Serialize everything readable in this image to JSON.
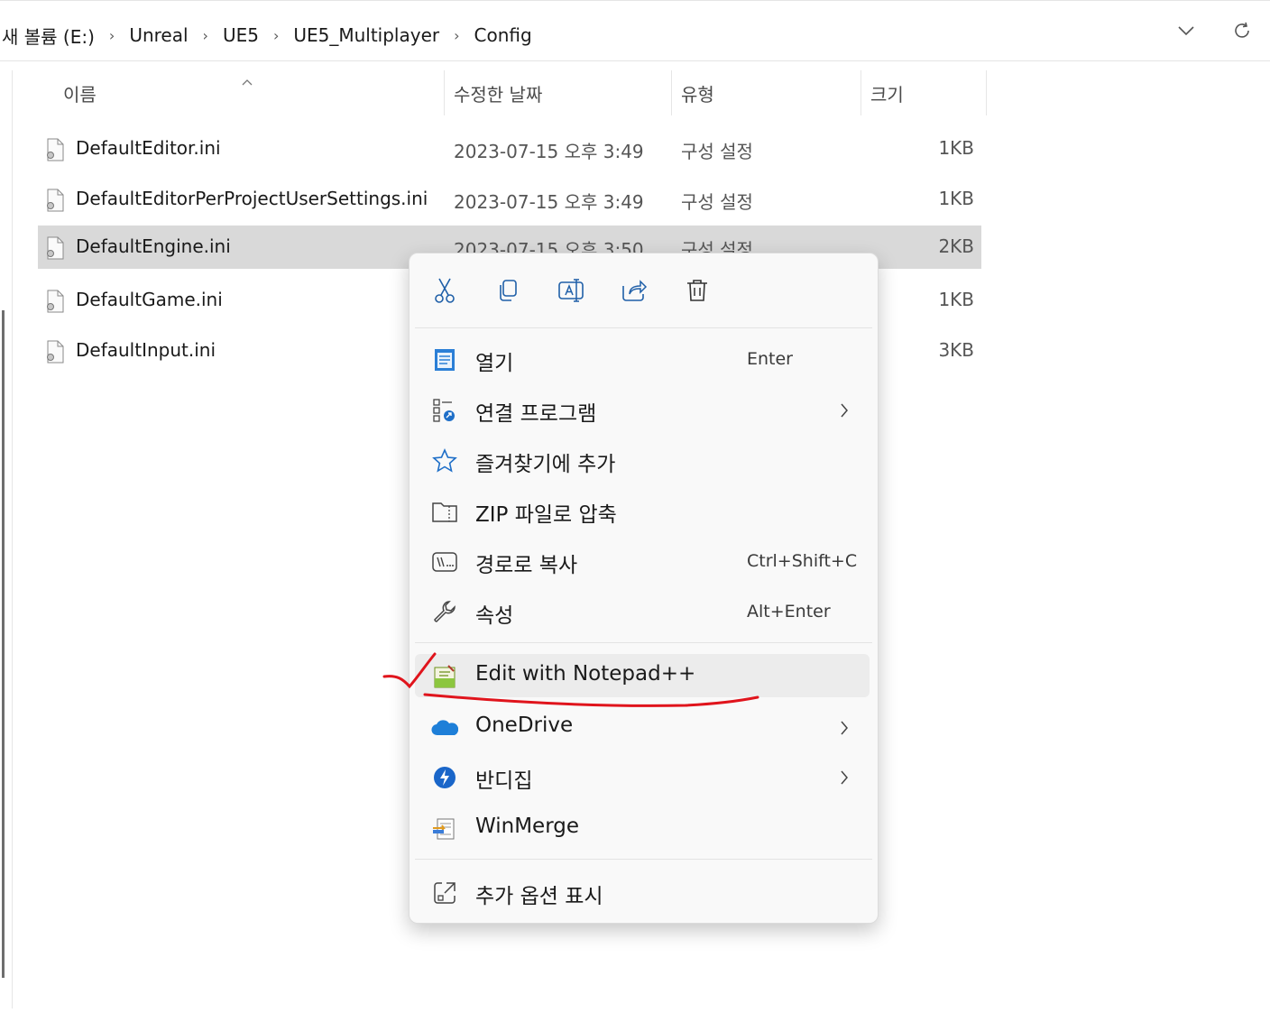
{
  "address": {
    "crumbs": [
      "새 볼륨 (E:)",
      "Unreal",
      "UE5",
      "UE5_Multiplayer",
      "Config"
    ],
    "separator": "›",
    "dropdown_icon": "chevron-down-icon",
    "refresh_icon": "refresh-icon"
  },
  "columns": {
    "name": "이름",
    "date": "수정한 날짜",
    "type": "유형",
    "size": "크기"
  },
  "files": [
    {
      "name": "DefaultEditor.ini",
      "date": "2023-07-15 오후 3:49",
      "type": "구성 설정",
      "size": "1KB"
    },
    {
      "name": "DefaultEditorPerProjectUserSettings.ini",
      "date": "2023-07-15 오후 3:49",
      "type": "구성 설정",
      "size": "1KB"
    },
    {
      "name": "DefaultEngine.ini",
      "date": "2023-07-15 오후 3:50",
      "type": "구성 설정",
      "size": "2KB"
    },
    {
      "name": "DefaultGame.ini",
      "date": "",
      "type": "",
      "size": "1KB"
    },
    {
      "name": "DefaultInput.ini",
      "date": "",
      "type": "",
      "size": "3KB"
    }
  ],
  "context_menu": {
    "toolbar": [
      "cut-icon",
      "copy-icon",
      "rename-icon",
      "share-icon",
      "delete-icon"
    ],
    "items": [
      {
        "label": "열기",
        "shortcut": "Enter",
        "icon": "notepad-icon"
      },
      {
        "label": "연결 프로그램",
        "shortcut": "",
        "icon": "open-with-icon"
      },
      {
        "label": "즐겨찾기에 추가",
        "shortcut": "",
        "icon": "star-icon"
      },
      {
        "label": "ZIP 파일로 압축",
        "shortcut": "",
        "icon": "zip-folder-icon"
      },
      {
        "label": "경로로 복사",
        "shortcut": "Ctrl+Shift+C",
        "icon": "copy-path-icon"
      },
      {
        "label": "속성",
        "shortcut": "Alt+Enter",
        "icon": "wrench-icon"
      },
      {
        "label": "Edit with Notepad++",
        "shortcut": "",
        "icon": "notepadpp-icon"
      },
      {
        "label": "OneDrive",
        "shortcut": "",
        "icon": "onedrive-icon"
      },
      {
        "label": "반디집",
        "shortcut": "",
        "icon": "bandizip-icon"
      },
      {
        "label": "WinMerge",
        "shortcut": "",
        "icon": "winmerge-icon"
      },
      {
        "label": "추가 옵션 표시",
        "shortcut": "",
        "icon": "more-options-icon"
      }
    ]
  },
  "colors": {
    "accent": "#0067c0",
    "selection": "#d9d9d9",
    "annotation": "#e0141c"
  }
}
